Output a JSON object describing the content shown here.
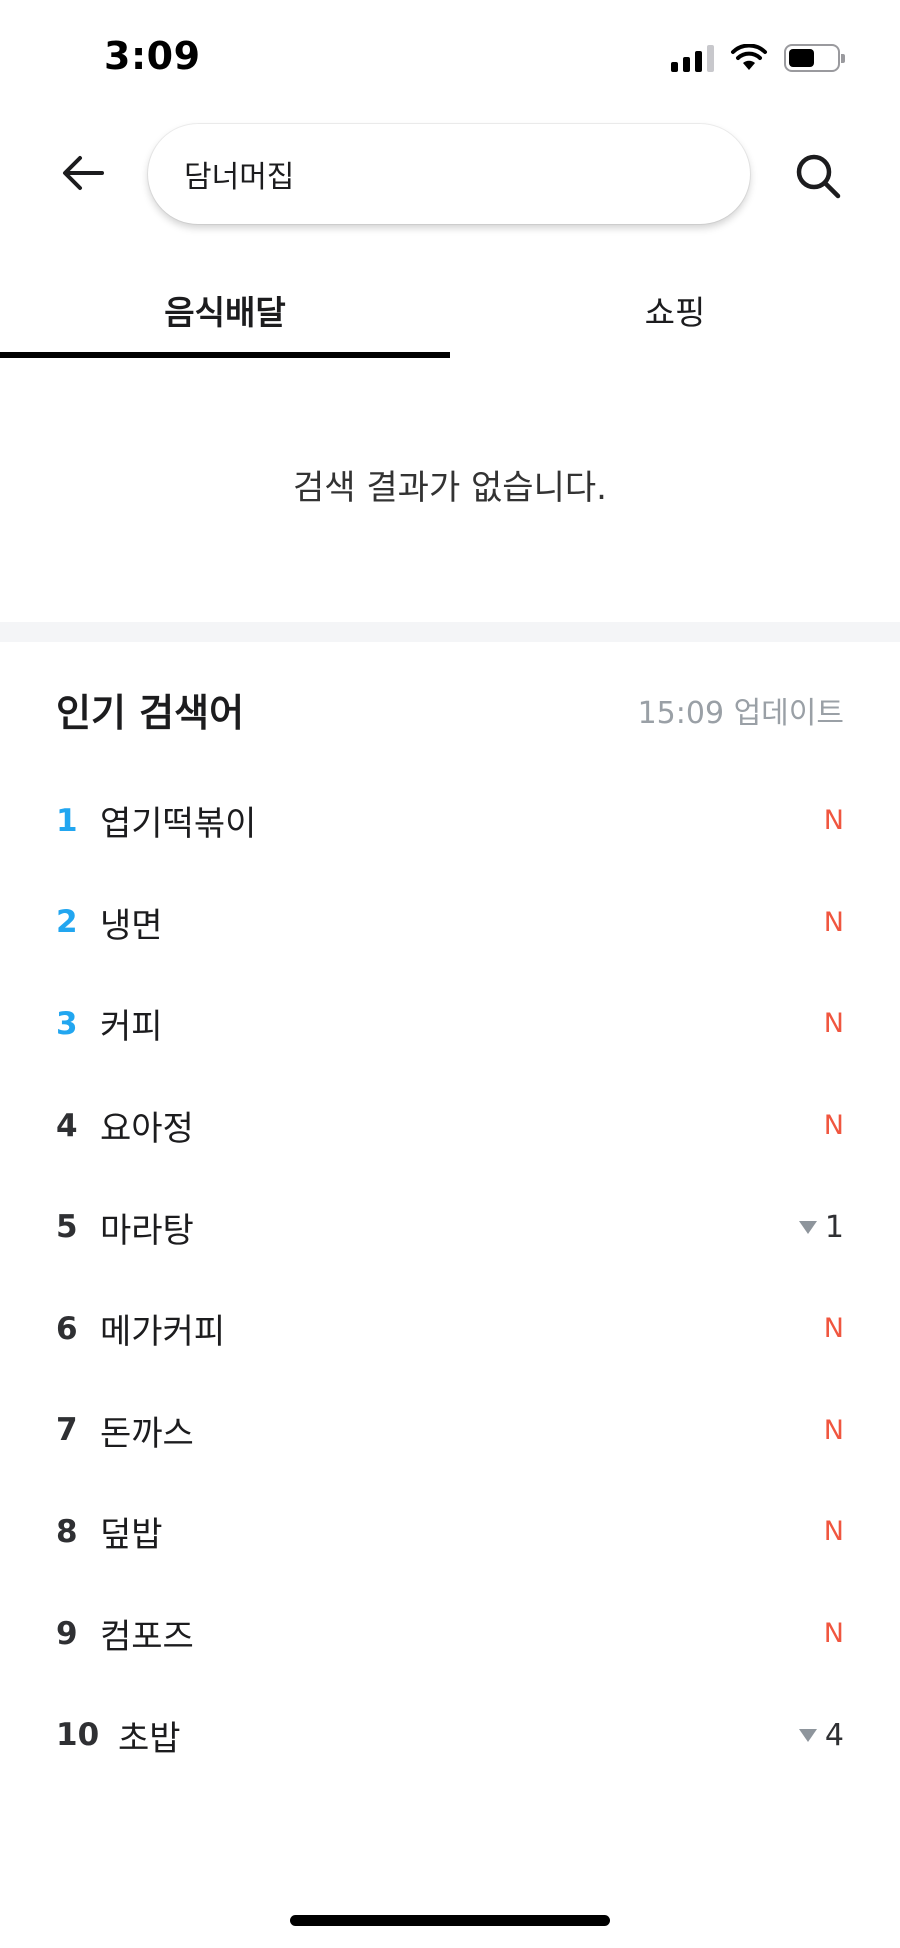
{
  "status_bar": {
    "time": "3:09"
  },
  "header": {
    "back_icon": "arrow-left-icon",
    "search_value": "담너머집",
    "search_icon": "search-icon"
  },
  "tabs": [
    {
      "label": "음식배달",
      "active": true
    },
    {
      "label": "쇼핑",
      "active": false
    }
  ],
  "empty_message": "검색 결과가 없습니다.",
  "popular": {
    "title": "인기 검색어",
    "updated": "15:09 업데이트",
    "items": [
      {
        "rank": "1",
        "label": "엽기떡볶이",
        "badge": "N"
      },
      {
        "rank": "2",
        "label": "냉면",
        "badge": "N"
      },
      {
        "rank": "3",
        "label": "커피",
        "badge": "N"
      },
      {
        "rank": "4",
        "label": "요아정",
        "badge": "N"
      },
      {
        "rank": "5",
        "label": "마라탕",
        "change": "1"
      },
      {
        "rank": "6",
        "label": "메가커피",
        "badge": "N"
      },
      {
        "rank": "7",
        "label": "돈까스",
        "badge": "N"
      },
      {
        "rank": "8",
        "label": "덮밥",
        "badge": "N"
      },
      {
        "rank": "9",
        "label": "컴포즈",
        "badge": "N"
      },
      {
        "rank": "10",
        "label": "초밥",
        "change": "4"
      }
    ]
  }
}
